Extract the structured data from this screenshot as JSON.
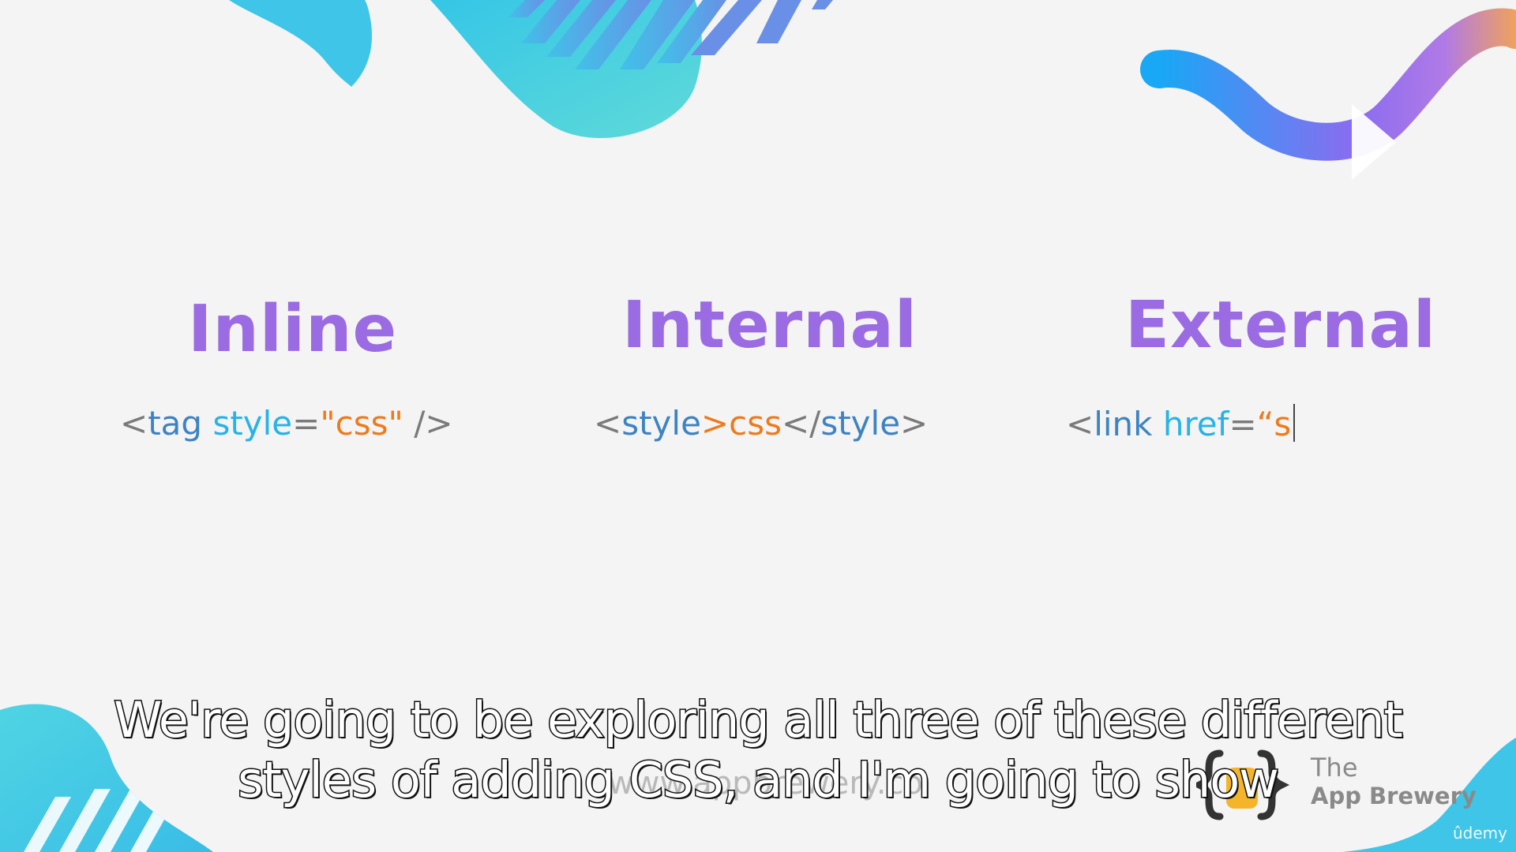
{
  "headings": {
    "inline": "Inline",
    "internal": "Internal",
    "external": "External"
  },
  "code_inline": {
    "open": "<",
    "tag": "tag",
    "space": " ",
    "attr": "style",
    "eq": "=",
    "value": "\"css\"",
    "close": " />"
  },
  "code_internal": {
    "open1": "<",
    "tag1": "style",
    "close1": ">",
    "content": "css",
    "open2": "</",
    "tag2": "style",
    "close2": ">"
  },
  "code_external": {
    "open": "<",
    "tag": "link",
    "space": " ",
    "attr": "href",
    "eq": "=",
    "value": "“s"
  },
  "watermark": "www.appbrewery.co",
  "brand": {
    "the": "The",
    "name": "App Brewery"
  },
  "platform": "ûdemy",
  "subtitles": {
    "line1": "We're going to be exploring all three of these different",
    "line2": "styles of adding CSS, and I'm going to show"
  },
  "colors": {
    "heading": "#9b6be3",
    "tag": "#3d83c4",
    "attr": "#27b3e8",
    "string": "#ef7a1c",
    "punct": "#7a7a7a",
    "background": "#f4f4f4"
  },
  "icons": [
    "play-icon",
    "brand-logo-icon"
  ]
}
